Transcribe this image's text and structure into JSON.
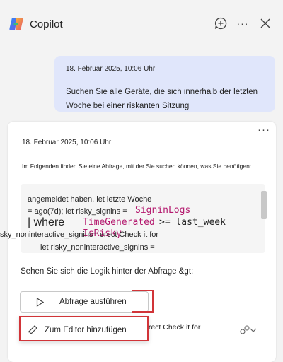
{
  "app": {
    "title": "Copilot"
  },
  "user_message": {
    "timestamp": "18. Februar 2025, 10:06 Uhr",
    "text": "Suchen Sie alle Geräte, die sich innerhalb der letzten Woche bei einer riskanten Sitzung"
  },
  "response": {
    "timestamp": "18. Februar 2025, 10:06 Uhr",
    "more_icon": "ellipsis-icon",
    "intro": "Im Folgenden finden Sie eine Abfrage, mit der Sie suchen können, was Sie benötigen:",
    "code_lines": {
      "l1": "angemeldet haben, let letzte Woche",
      "l2a": "= ago(7d); let risky_signins =",
      "l2b": "SigninLogs",
      "l3a": "| where",
      "l3b": "TimeGenerated",
      "l3c": ">= last_week",
      "l4a": "sky_noninteractive_signins= erect Check it for",
      "l4b": "IsRisky",
      "l5": "let risky_noninteractive_signins ="
    },
    "see_logic": "Sehen Sie sich die Logik hinter der Abfrage &gt;",
    "run_button": "Abfrage ausführen",
    "tail_text": "erect Check it for",
    "menu_item": "Zum Editor hinzufügen"
  },
  "colors": {
    "accent": "#d13438",
    "bubble": "#e0e6fb",
    "kql_keyword": "#b4196e"
  }
}
